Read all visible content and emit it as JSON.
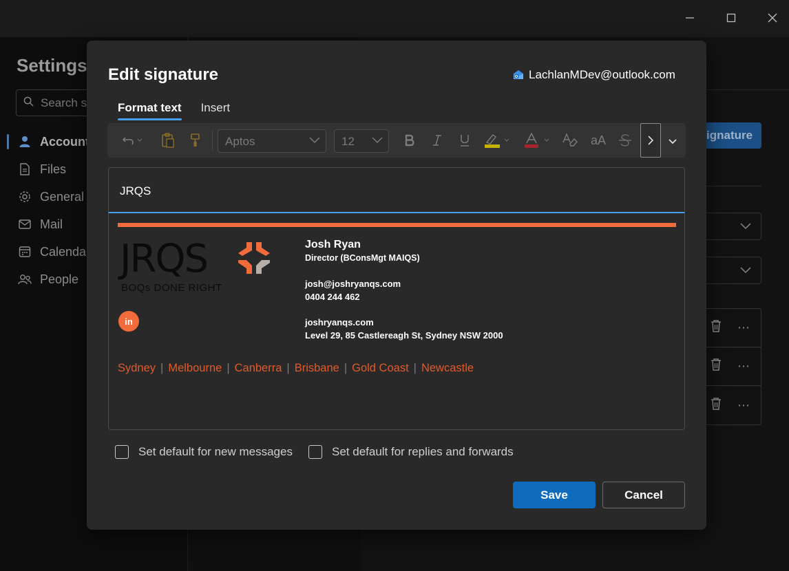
{
  "background": {
    "settings_title": "Settings",
    "search_placeholder": "Search se",
    "nav": [
      {
        "label": "Accounts",
        "icon": "person-icon",
        "active": true
      },
      {
        "label": "Files",
        "icon": "file-icon"
      },
      {
        "label": "General",
        "icon": "gear-icon"
      },
      {
        "label": "Mail",
        "icon": "mail-icon"
      },
      {
        "label": "Calendar",
        "icon": "calendar-icon"
      },
      {
        "label": "People",
        "icon": "people-icon"
      }
    ],
    "new_signature_label": "ignature"
  },
  "dialog": {
    "title": "Edit signature",
    "account_email": "LachlanMDev@outlook.com",
    "tabs": [
      {
        "label": "Format text",
        "active": true
      },
      {
        "label": "Insert",
        "active": false
      }
    ],
    "toolbar": {
      "font_name": "Aptos",
      "font_size": "12"
    },
    "signature_name": "JRQS",
    "signature": {
      "logo_text": "JRQS",
      "logo_tagline": "BOQs DONE RIGHT",
      "linkedin_label": "in",
      "name": "Josh Ryan",
      "role": "Director (BConsMgt MAIQS)",
      "email": "josh@joshryanqs.com",
      "phone": "0404 244 462",
      "website": "joshryanqs.com",
      "address": "Level 29, 85 Castlereagh St, Sydney NSW 2000",
      "cities": [
        "Sydney",
        "Melbourne",
        "Canberra",
        "Brisbane",
        "Gold Coast",
        "Newcastle"
      ],
      "separator": "|",
      "accent_color": "#f26b3a"
    },
    "checkboxes": {
      "new_messages": "Set default for new messages",
      "replies_forwards": "Set default for replies and forwards"
    },
    "save_label": "Save",
    "cancel_label": "Cancel"
  },
  "colors": {
    "primary_button": "#0f6cbd",
    "tab_indicator": "#479ef5",
    "city_link": "#e05a2b"
  }
}
